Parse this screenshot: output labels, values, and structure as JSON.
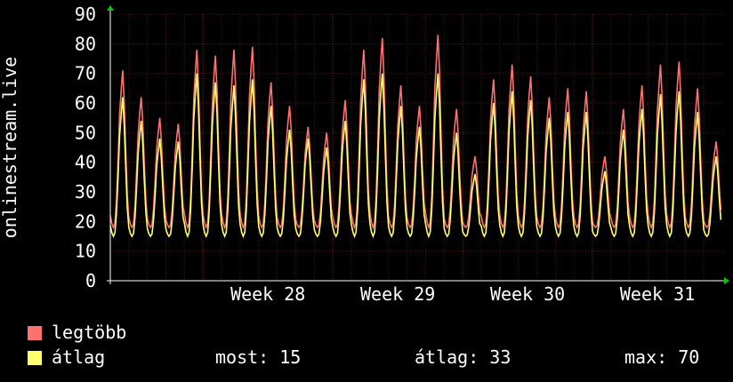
{
  "chart_data": {
    "type": "line",
    "ylabel": "onlinestream.live",
    "ylim": [
      0,
      90
    ],
    "yticks": [
      "0",
      "10",
      "20",
      "30",
      "40",
      "50",
      "60",
      "70",
      "80",
      "90"
    ],
    "xtick_labels": [
      "Week 28",
      "Week 29",
      "Week 30",
      "Week 31"
    ],
    "grid": true,
    "days": 33,
    "series": [
      {
        "name": "legtöbb",
        "color": "#ff7070",
        "daily_peaks": [
          71,
          62,
          55,
          53,
          78,
          76,
          78,
          79,
          67,
          59,
          52,
          50,
          61,
          78,
          82,
          66,
          59,
          83,
          58,
          42,
          68,
          73,
          69,
          62,
          65,
          64,
          42,
          58,
          66,
          73,
          74,
          65,
          47
        ]
      },
      {
        "name": "átlag",
        "color": "#ffff70",
        "daily_peaks": [
          62,
          54,
          48,
          47,
          70,
          67,
          66,
          68,
          59,
          51,
          48,
          45,
          54,
          68,
          70,
          59,
          52,
          70,
          50,
          36,
          60,
          64,
          61,
          55,
          57,
          57,
          37,
          51,
          58,
          63,
          64,
          57,
          42
        ]
      }
    ],
    "legend": [
      {
        "label": "legtöbb",
        "color": "#ff7070"
      },
      {
        "label": "átlag",
        "color": "#ffff70"
      }
    ],
    "stats": {
      "most": "most: 15",
      "atlag": "átlag: 33",
      "max": "max: 70"
    }
  }
}
